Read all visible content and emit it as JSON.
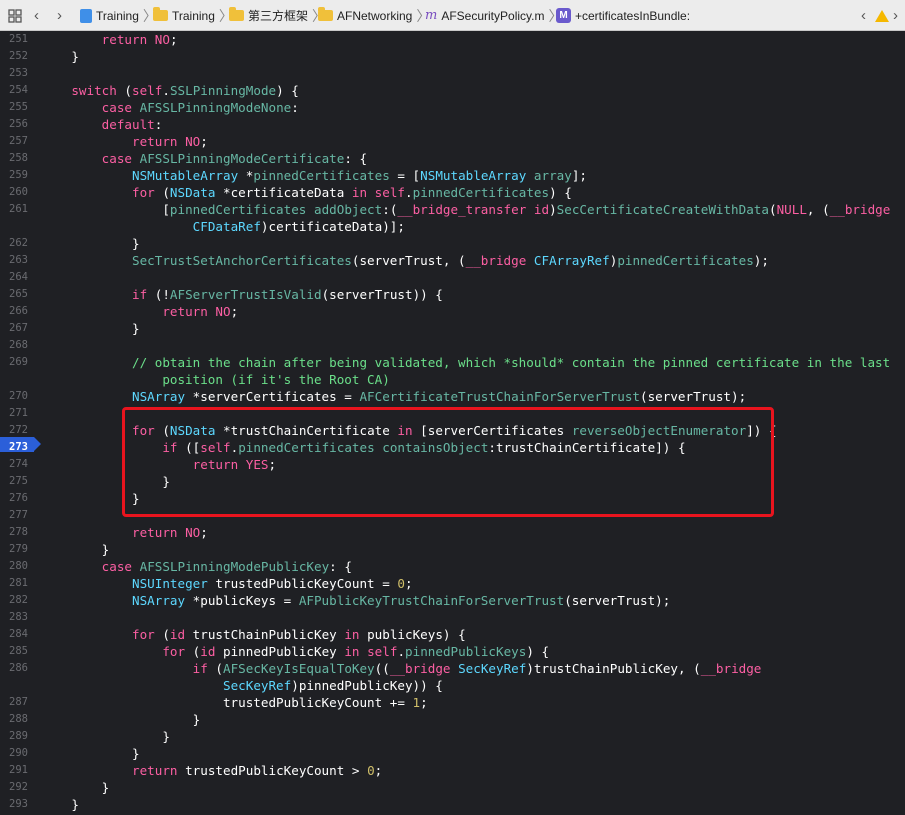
{
  "toolbar": {
    "crumbs": [
      "Training",
      "Training",
      "第三方框架",
      "AFNetworking",
      "AFSecurityPolicy.m",
      "+certificatesInBundle:"
    ],
    "mfile_glyph": "m",
    "mbadge_glyph": "M",
    "back_icon": "chevron-left-icon",
    "forward_icon": "chevron-right-icon",
    "grid_icon": "related-items-grid-icon",
    "warning_icon": "warning-triangle-icon",
    "warning_color": "#f5b800"
  },
  "editor": {
    "current_line": "273",
    "highlight_color": "#e8141e",
    "lines": [
      {
        "n": "251",
        "code": "        return NO;"
      },
      {
        "n": "252",
        "code": "    }"
      },
      {
        "n": "253",
        "code": ""
      },
      {
        "n": "254",
        "code": "    switch (self.SSLPinningMode) {"
      },
      {
        "n": "255",
        "code": "        case AFSSLPinningModeNone:"
      },
      {
        "n": "256",
        "code": "        default:"
      },
      {
        "n": "257",
        "code": "            return NO;"
      },
      {
        "n": "258",
        "code": "        case AFSSLPinningModeCertificate: {"
      },
      {
        "n": "259",
        "code": "            NSMutableArray *pinnedCertificates = [NSMutableArray array];"
      },
      {
        "n": "260",
        "code": "            for (NSData *certificateData in self.pinnedCertificates) {"
      },
      {
        "n": "261",
        "code": "                [pinnedCertificates addObject:(__bridge_transfer id)SecCertificateCreateWithData(NULL, (__bridge"
      },
      {
        "n": "",
        "code": "                    CFDataRef)certificateData)];"
      },
      {
        "n": "262",
        "code": "            }"
      },
      {
        "n": "263",
        "code": "            SecTrustSetAnchorCertificates(serverTrust, (__bridge CFArrayRef)pinnedCertificates);"
      },
      {
        "n": "264",
        "code": ""
      },
      {
        "n": "265",
        "code": "            if (!AFServerTrustIsValid(serverTrust)) {"
      },
      {
        "n": "266",
        "code": "                return NO;"
      },
      {
        "n": "267",
        "code": "            }"
      },
      {
        "n": "268",
        "code": ""
      },
      {
        "n": "269",
        "code": "            // obtain the chain after being validated, which *should* contain the pinned certificate in the last"
      },
      {
        "n": "",
        "code": "                position (if it's the Root CA)"
      },
      {
        "n": "270",
        "code": "            NSArray *serverCertificates = AFCertificateTrustChainForServerTrust(serverTrust);"
      },
      {
        "n": "271",
        "code": ""
      },
      {
        "n": "272",
        "code": "            for (NSData *trustChainCertificate in [serverCertificates reverseObjectEnumerator]) {"
      },
      {
        "n": "273",
        "code": "                if ([self.pinnedCertificates containsObject:trustChainCertificate]) {"
      },
      {
        "n": "274",
        "code": "                    return YES;"
      },
      {
        "n": "275",
        "code": "                }"
      },
      {
        "n": "276",
        "code": "            }"
      },
      {
        "n": "277",
        "code": ""
      },
      {
        "n": "278",
        "code": "            return NO;"
      },
      {
        "n": "279",
        "code": "        }"
      },
      {
        "n": "280",
        "code": "        case AFSSLPinningModePublicKey: {"
      },
      {
        "n": "281",
        "code": "            NSUInteger trustedPublicKeyCount = 0;"
      },
      {
        "n": "282",
        "code": "            NSArray *publicKeys = AFPublicKeyTrustChainForServerTrust(serverTrust);"
      },
      {
        "n": "283",
        "code": ""
      },
      {
        "n": "284",
        "code": "            for (id trustChainPublicKey in publicKeys) {"
      },
      {
        "n": "285",
        "code": "                for (id pinnedPublicKey in self.pinnedPublicKeys) {"
      },
      {
        "n": "286",
        "code": "                    if (AFSecKeyIsEqualToKey((__bridge SecKeyRef)trustChainPublicKey, (__bridge"
      },
      {
        "n": "",
        "code": "                        SecKeyRef)pinnedPublicKey)) {"
      },
      {
        "n": "287",
        "code": "                        trustedPublicKeyCount += 1;"
      },
      {
        "n": "288",
        "code": "                    }"
      },
      {
        "n": "289",
        "code": "                }"
      },
      {
        "n": "290",
        "code": "            }"
      },
      {
        "n": "291",
        "code": "            return trustedPublicKeyCount > 0;"
      },
      {
        "n": "292",
        "code": "        }"
      },
      {
        "n": "293",
        "code": "    }"
      }
    ]
  }
}
